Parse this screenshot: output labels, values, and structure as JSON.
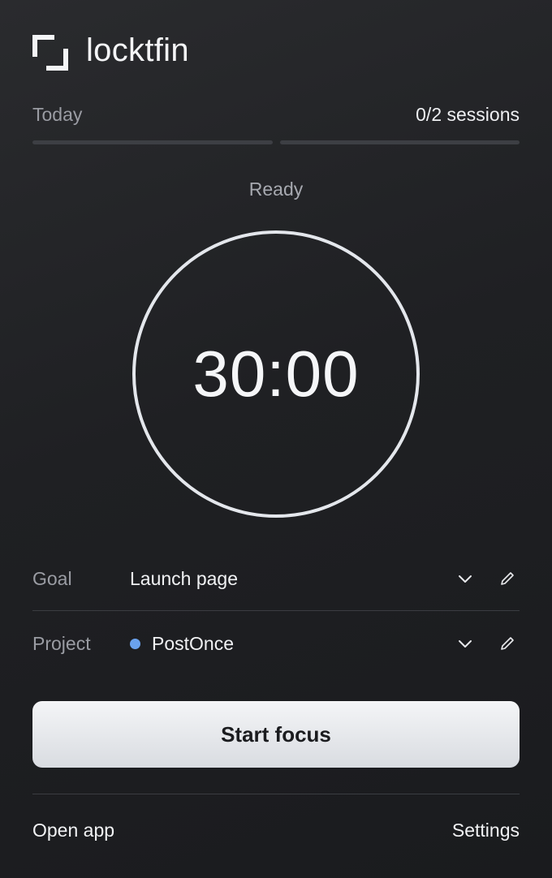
{
  "app": {
    "name": "locktfin"
  },
  "today": {
    "label": "Today",
    "sessions_text": "0/2 sessions",
    "sessions_done": 0,
    "sessions_total": 2
  },
  "timer": {
    "status": "Ready",
    "time": "30:00"
  },
  "fields": {
    "goal": {
      "label": "Goal",
      "value": "Launch page"
    },
    "project": {
      "label": "Project",
      "value": "PostOnce",
      "color": "#6aa2ee"
    }
  },
  "actions": {
    "start_label": "Start focus"
  },
  "footer": {
    "open_app_label": "Open app",
    "settings_label": "Settings"
  },
  "icons": {
    "logo": "bracket-frame-icon",
    "dropdown": "chevron-down-icon",
    "edit": "pencil-icon"
  },
  "colors": {
    "background": "#1f2023",
    "ring": "#e4e7ec",
    "accent_dot": "#6aa2ee",
    "button": "#e6e8ec"
  }
}
